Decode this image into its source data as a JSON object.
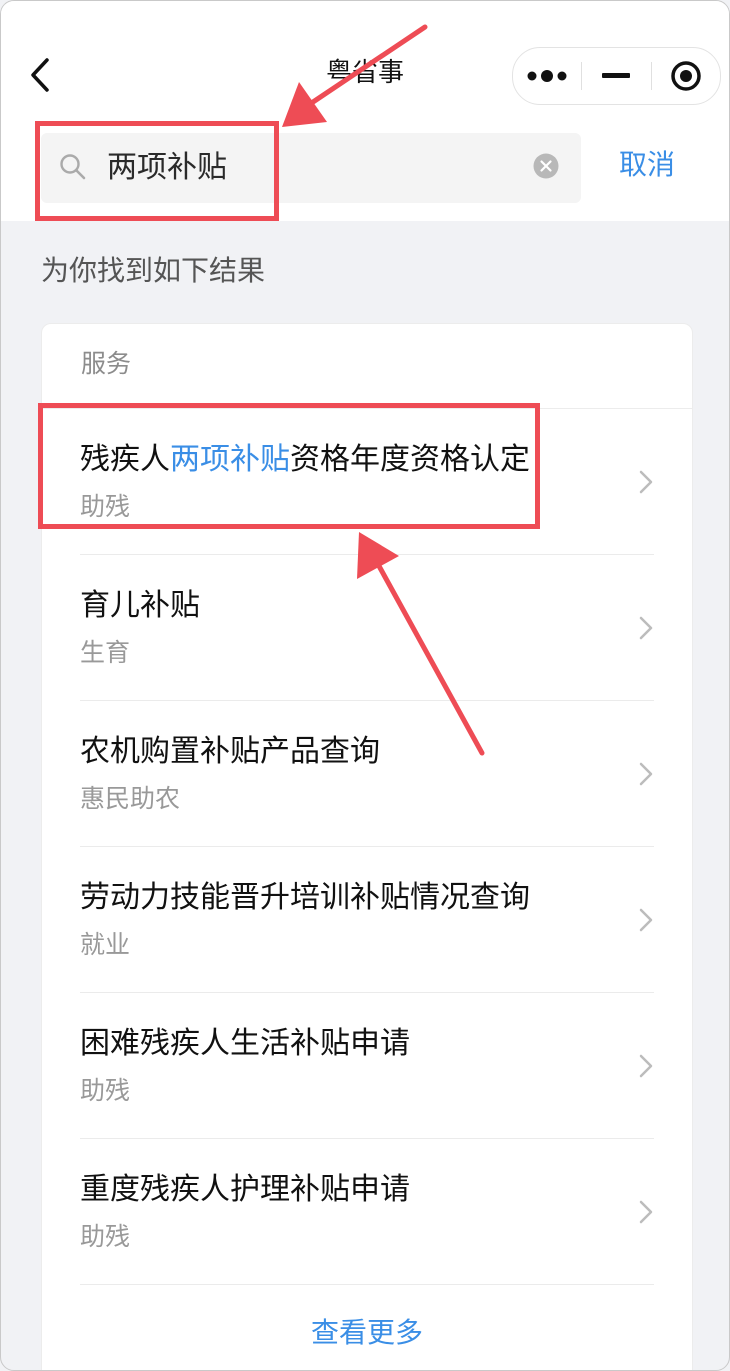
{
  "app": {
    "title": "粤省事"
  },
  "icons": {
    "back": "chevron-left-icon",
    "more": "more-dots-icon",
    "minimize": "minimize-icon",
    "close": "target-close-icon",
    "search": "search-icon",
    "clear": "clear-icon",
    "row_arrow": "chevron-right-icon"
  },
  "search": {
    "value": "两项补贴",
    "cancel_label": "取消"
  },
  "results": {
    "hint": "为你找到如下结果",
    "section_label": "服务",
    "items": [
      {
        "title_prefix": "残疾人",
        "title_highlight": "两项补贴",
        "title_suffix": "资格年度资格认定",
        "category": "助残"
      },
      {
        "title": "育儿补贴",
        "category": "生育"
      },
      {
        "title": "农机购置补贴产品查询",
        "category": "惠民助农"
      },
      {
        "title": "劳动力技能晋升培训补贴情况查询",
        "category": "就业"
      },
      {
        "title": "困难残疾人生活补贴申请",
        "category": "助残"
      },
      {
        "title": "重度残疾人护理补贴申请",
        "category": "助残"
      }
    ],
    "more_label": "查看更多"
  },
  "colors": {
    "accent": "#3a8ee6",
    "annotation": "#ee4c55",
    "background": "#f1f2f5",
    "text_primary": "#111111",
    "text_secondary": "#999999"
  }
}
